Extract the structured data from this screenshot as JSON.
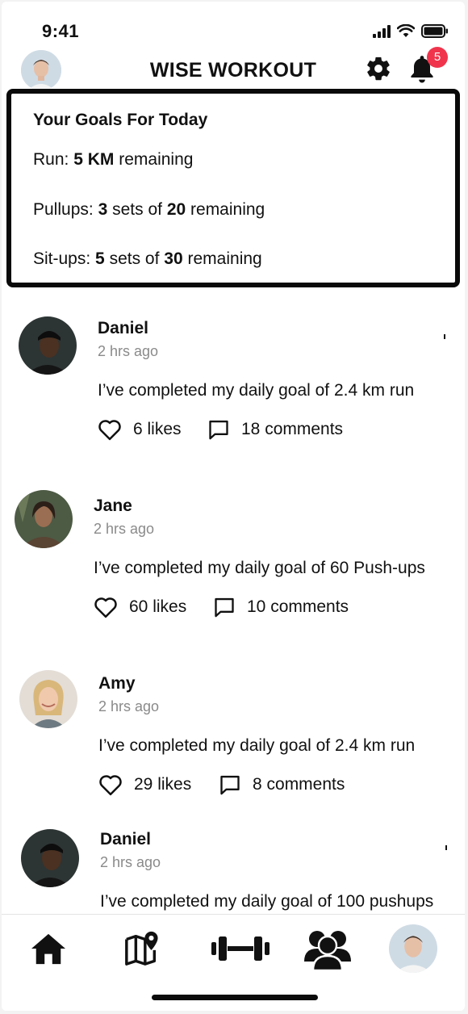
{
  "status_bar": {
    "time": "9:41"
  },
  "header": {
    "title": "WISE WORKOUT",
    "notification_count": "5"
  },
  "goals": {
    "title": "Your Goals For Today",
    "run": {
      "label": "Run:",
      "amount": "5 KM",
      "suffix": "remaining"
    },
    "pullups": {
      "label": "Pullups:",
      "sets": "3",
      "sets_of": "sets of",
      "reps": "20",
      "suffix": "remaining"
    },
    "situps": {
      "label": "Sit-ups:",
      "sets": "5",
      "sets_of": "sets of",
      "reps": "30",
      "suffix": "remaining"
    }
  },
  "posts": [
    {
      "name": "Daniel",
      "time": "2 hrs ago",
      "message": "I’ve completed my daily goal of 2.4 km run",
      "likes": "6 likes",
      "comments": "18 comments"
    },
    {
      "name": "Jane",
      "time": "2 hrs ago",
      "message": "I’ve completed my daily goal of 60 Push-ups",
      "likes": "60 likes",
      "comments": "10 comments"
    },
    {
      "name": "Amy",
      "time": "2 hrs ago",
      "message": "I’ve completed my daily goal of 2.4 km run",
      "likes": "29 likes",
      "comments": "8 comments"
    },
    {
      "name": "Daniel",
      "time": "2 hrs ago",
      "message": "I’ve completed my daily goal of 100 pushups",
      "likes": "",
      "comments": ""
    }
  ],
  "nav": {
    "items": [
      "home-icon",
      "map-icon",
      "dumbbell-icon",
      "group-icon",
      "profile-avatar"
    ]
  }
}
